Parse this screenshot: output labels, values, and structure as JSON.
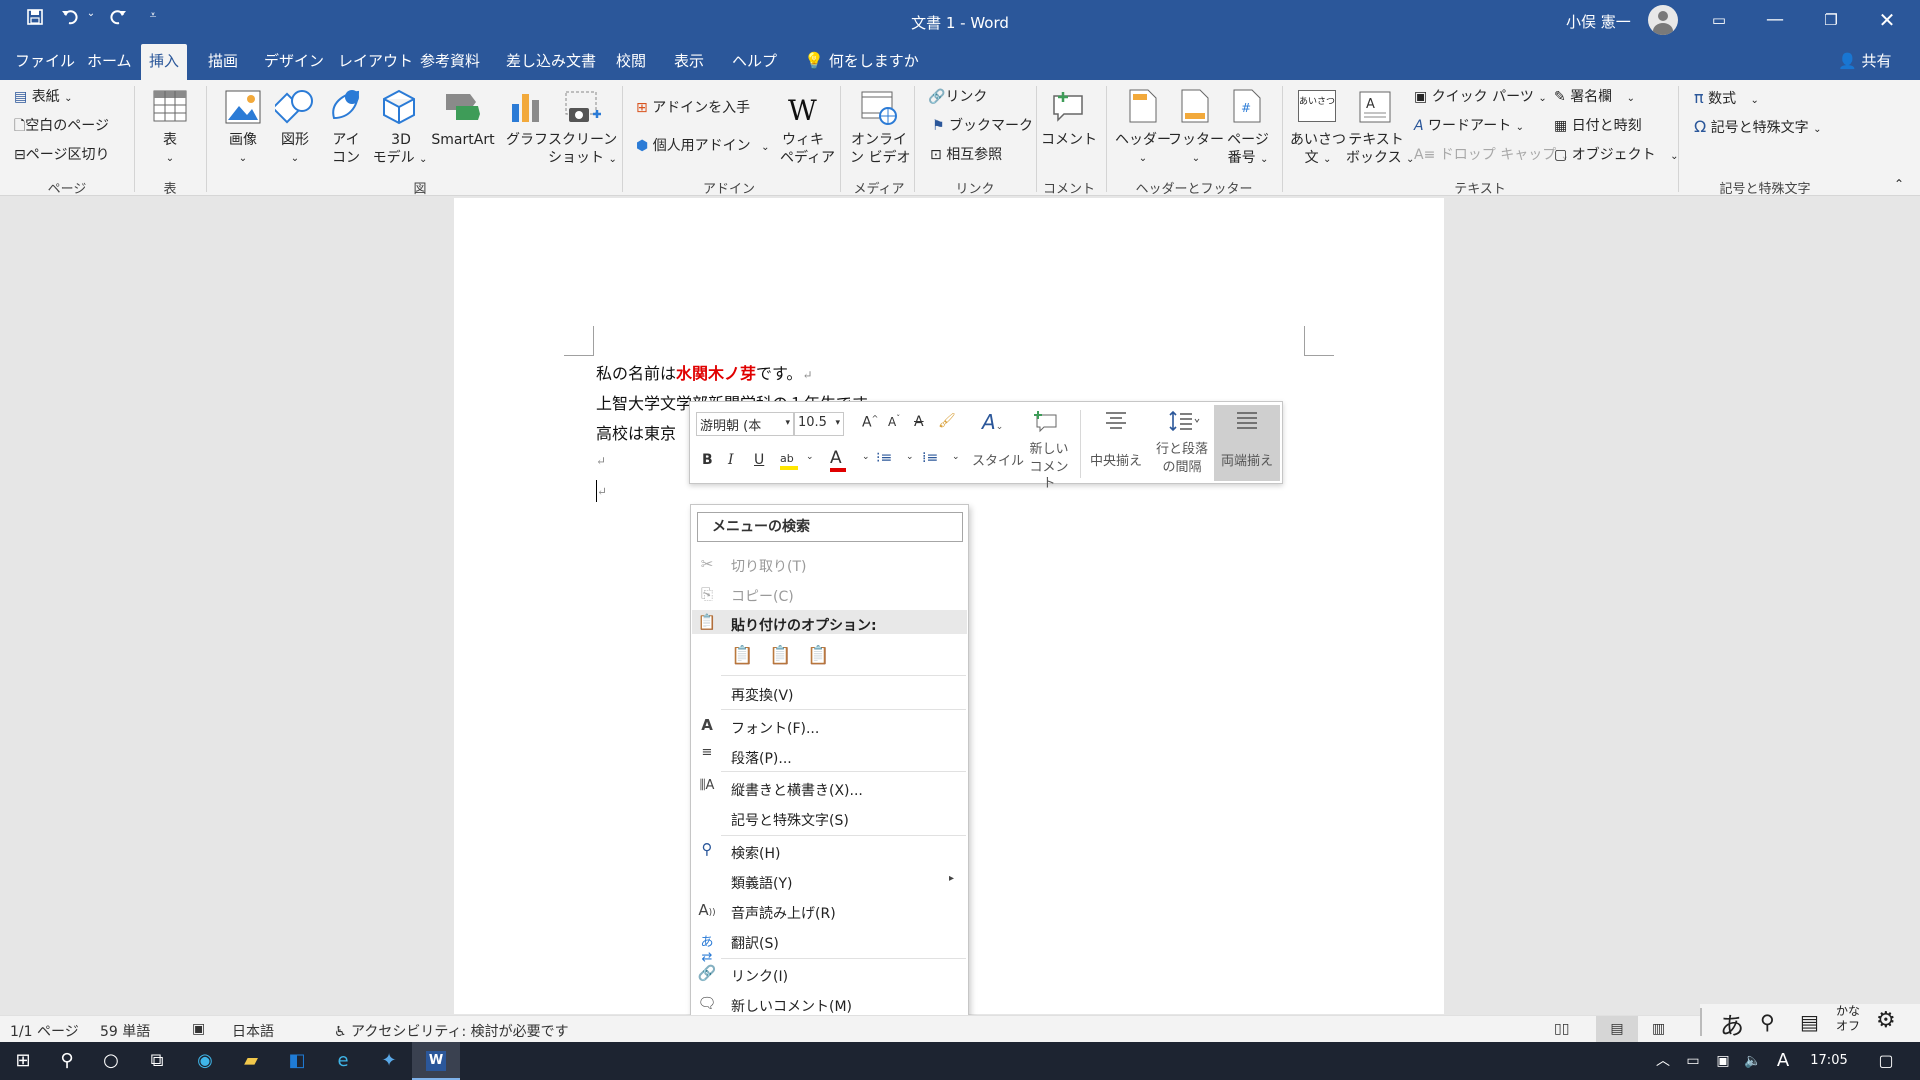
{
  "titlebar": {
    "doc_title": "文書 1  -  Word",
    "user_name": "小俣 憲一",
    "qat": [
      "save-icon",
      "undo-icon",
      "redo-icon",
      "customize-icon"
    ]
  },
  "tabs": [
    "ファイル",
    "ホーム",
    "挿入",
    "描画",
    "デザイン",
    "レイアウト",
    "参考資料",
    "差し込み文書",
    "校閲",
    "表示",
    "ヘルプ",
    "何をしますか"
  ],
  "active_tab": "挿入",
  "share_label": "共有",
  "ribbon": {
    "page_group": {
      "cover": "表紙",
      "blank": "空白のページ",
      "break": "ページ区切り",
      "label": "ページ"
    },
    "table_group": {
      "table": "表",
      "label": "表"
    },
    "figure_group": {
      "image": "画像",
      "shape": "図形",
      "icon1": "アイ",
      "icon2": "コン",
      "model1": "3D",
      "model2": "モデル",
      "smartart": "SmartArt",
      "graph": "グラフ",
      "screen1": "スクリーン",
      "screen2": "ショット",
      "label": "図"
    },
    "addin_group": {
      "get": "アドインを入手",
      "personal": "個人用アドイン",
      "wiki1": "ウィキ",
      "wiki2": "ペディア",
      "label": "アドイン"
    },
    "media_group": {
      "video1": "オンライ",
      "video2": "ン ビデオ",
      "label": "メディア"
    },
    "link_group": {
      "link": "リンク",
      "bookmark": "ブックマーク",
      "crossref": "相互参照",
      "label": "リンク"
    },
    "comment_group": {
      "comment": "コメント",
      "label": "コメント"
    },
    "hf_group": {
      "header": "ヘッダー",
      "footer": "フッター",
      "pn1": "ページ",
      "pn2": "番号",
      "label": "ヘッダーとフッター"
    },
    "text_group": {
      "greet1": "あいさつ",
      "greet2": "文",
      "tb1": "テキスト",
      "tb2": "ボックス",
      "quick": "クイック パーツ",
      "wordart": "ワードアート",
      "dropcap": "ドロップ キャップ",
      "signature": "署名欄",
      "datetime": "日付と時刻",
      "object": "オブジェクト",
      "label": "テキスト",
      "greet_icon_text": "あいさつ"
    },
    "symbol_group": {
      "equation": "数式",
      "symbol": "記号と特殊文字",
      "label": "記号と特殊文字"
    }
  },
  "document": {
    "line1_pre": "私の名前は",
    "line1_name": "水関木ノ芽",
    "line1_post": "です。",
    "line2": "上智大学文学部新聞学科の１年生です。",
    "line3": "高校は東京",
    "para_mark": "↵"
  },
  "minitoolbar": {
    "font": "游明朝 (本",
    "size": "10.5",
    "style": "スタイル",
    "new_comment1": "新しい",
    "new_comment2": "コメント",
    "center": "中央揃え",
    "spacing1": "行と段落",
    "spacing2": "の間隔",
    "justify": "両端揃え",
    "colors": {
      "highlight": "#ffe600",
      "font_color": "#e00000"
    }
  },
  "context_menu": {
    "search": "メニューの検索",
    "cut": "切り取り(T)",
    "copy": "コピー(C)",
    "paste_options": "貼り付けのオプション:",
    "reconvert": "再変換(V)",
    "font": "フォント(F)...",
    "paragraph": "段落(P)...",
    "direction": "縦書きと横書き(X)...",
    "symbols": "記号と特殊文字(S)",
    "search_item": "検索(H)",
    "synonyms": "類義語(Y)",
    "read_aloud": "音声読み上げ(R)",
    "translate": "翻訳(S)",
    "link": "リンク(I)",
    "new_comment": "新しいコメント(M)"
  },
  "statusbar": {
    "page": "1/1 ページ",
    "words": "59 単語",
    "language": "日本語",
    "accessibility": "アクセシビリティ: 検討が必要です"
  },
  "tray": {
    "ime": "あ",
    "kana1": "かな",
    "kana2": "オフ",
    "ime_a": "A",
    "time": "17:05"
  },
  "accent_color": "#2b579a"
}
